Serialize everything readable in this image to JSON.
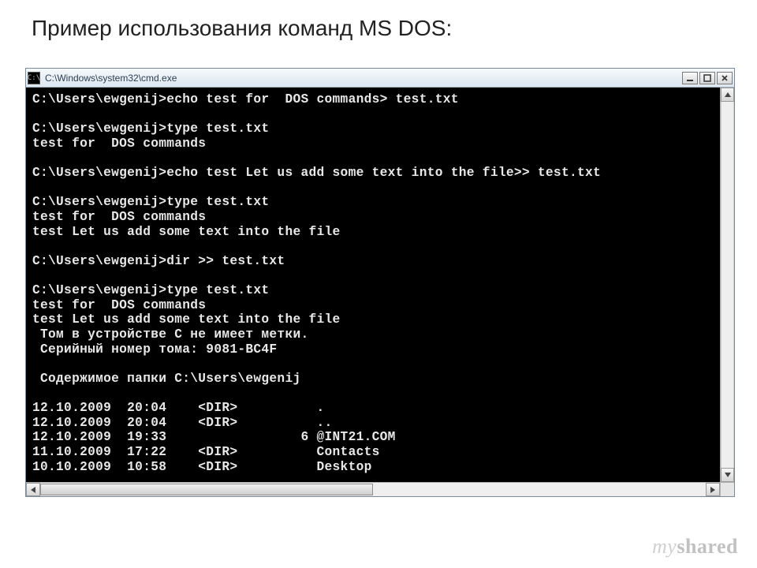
{
  "page_title": "Пример использования команд MS DOS:",
  "window": {
    "sysicon_glyph": "C:\\",
    "title": "C:\\Windows\\system32\\cmd.exe"
  },
  "terminal_lines": [
    "C:\\Users\\ewgenij>echo test for  DOS commands> test.txt",
    "",
    "C:\\Users\\ewgenij>type test.txt",
    "test for  DOS commands",
    "",
    "C:\\Users\\ewgenij>echo test Let us add some text into the file>> test.txt",
    "",
    "C:\\Users\\ewgenij>type test.txt",
    "test for  DOS commands",
    "test Let us add some text into the file",
    "",
    "C:\\Users\\ewgenij>dir >> test.txt",
    "",
    "C:\\Users\\ewgenij>type test.txt",
    "test for  DOS commands",
    "test Let us add some text into the file",
    " Том в устройстве C не имеет метки.",
    " Серийный номер тома: 9081-BC4F",
    "",
    " Содержимое папки C:\\Users\\ewgenij",
    "",
    "12.10.2009  20:04    <DIR>          .",
    "12.10.2009  20:04    <DIR>          ..",
    "12.10.2009  19:33                 6 @INT21.COM",
    "11.10.2009  17:22    <DIR>          Contacts",
    "10.10.2009  10:58    <DIR>          Desktop"
  ],
  "watermark_prefix": "my",
  "watermark_suffix": "shared"
}
